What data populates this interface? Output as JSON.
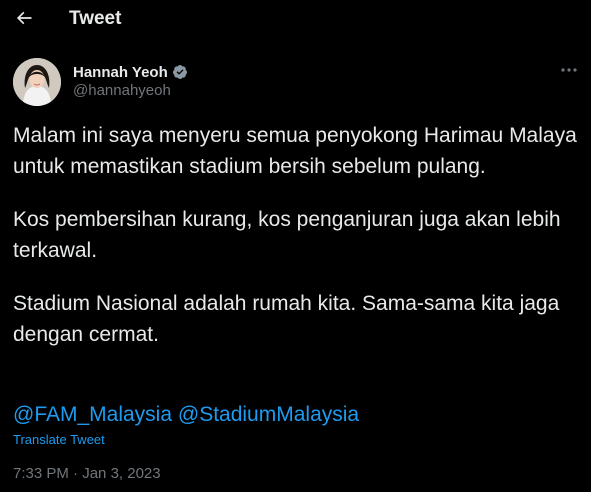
{
  "header": {
    "title": "Tweet",
    "back_icon": "arrow-left-icon"
  },
  "author": {
    "display_name": "Hannah Yeoh",
    "handle": "@hannahyeoh",
    "verified": true,
    "verified_color": "#8b98a5"
  },
  "tweet": {
    "paragraphs": [
      "Malam ini saya menyeru semua penyokong Harimau Malaya untuk memastikan stadium bersih sebelum pulang.",
      "Kos pembersihan kurang, kos penganjuran juga akan lebih terkawal.",
      "Stadium Nasional adalah rumah kita. Sama-sama kita jaga dengan cermat."
    ],
    "mentions": [
      "@FAM_Malaysia",
      "@StadiumMalaysia"
    ],
    "translate_label": "Translate Tweet",
    "time": "7:33 PM",
    "separator": "·",
    "date": "Jan 3, 2023"
  },
  "colors": {
    "background": "#000000",
    "text": "#e7e9ea",
    "secondary": "#71767b",
    "link": "#1d9bf0"
  }
}
